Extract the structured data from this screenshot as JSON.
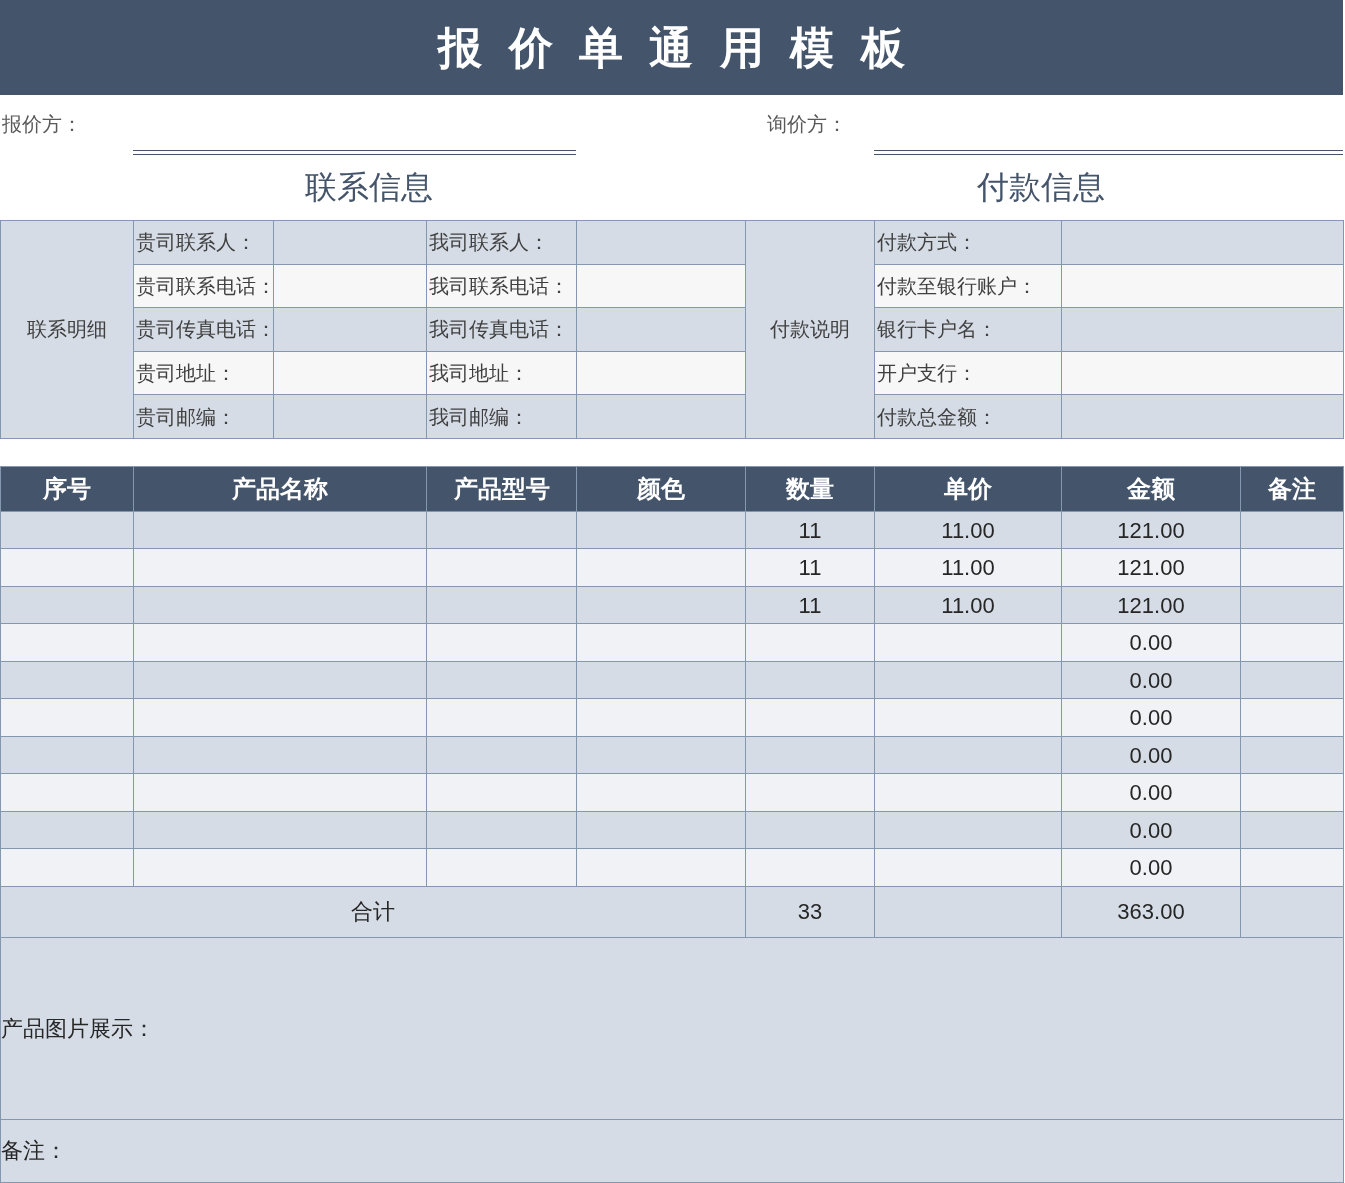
{
  "title": "报价单通用模板",
  "parties": [
    {
      "label": "报价方："
    },
    {
      "label": "询价方："
    }
  ],
  "sections": [
    "联系信息",
    "付款信息"
  ],
  "contact": {
    "group_label": "联系明细",
    "rows": [
      {
        "left": "贵司联系人：",
        "right": "我司联系人："
      },
      {
        "left": "贵司联系电话：",
        "right": "我司联系电话："
      },
      {
        "left": "贵司传真电话：",
        "right": "我司传真电话："
      },
      {
        "left": "贵司地址：",
        "right": "我司地址："
      },
      {
        "left": "贵司邮编：",
        "right": "我司邮编："
      }
    ]
  },
  "payment": {
    "group_label": "付款说明",
    "rows": [
      "付款方式：",
      "付款至银行账户：",
      "银行卡户名：",
      "开户支行：",
      "付款总金额："
    ]
  },
  "products": {
    "columns": [
      "序号",
      "产品名称",
      "产品型号",
      "颜色",
      "数量",
      "单价",
      "金额",
      "备注"
    ],
    "rows": [
      {
        "qty": "11",
        "price": "11.00",
        "amount": "121.00"
      },
      {
        "qty": "11",
        "price": "11.00",
        "amount": "121.00"
      },
      {
        "qty": "11",
        "price": "11.00",
        "amount": "121.00"
      },
      {
        "amount": "0.00"
      },
      {
        "amount": "0.00"
      },
      {
        "amount": "0.00"
      },
      {
        "amount": "0.00"
      },
      {
        "amount": "0.00"
      },
      {
        "amount": "0.00"
      },
      {
        "amount": "0.00"
      }
    ],
    "total": {
      "label": "合计",
      "qty": "33",
      "amount": "363.00"
    }
  },
  "picture_label": "产品图片展示：",
  "notes_label": "备注："
}
